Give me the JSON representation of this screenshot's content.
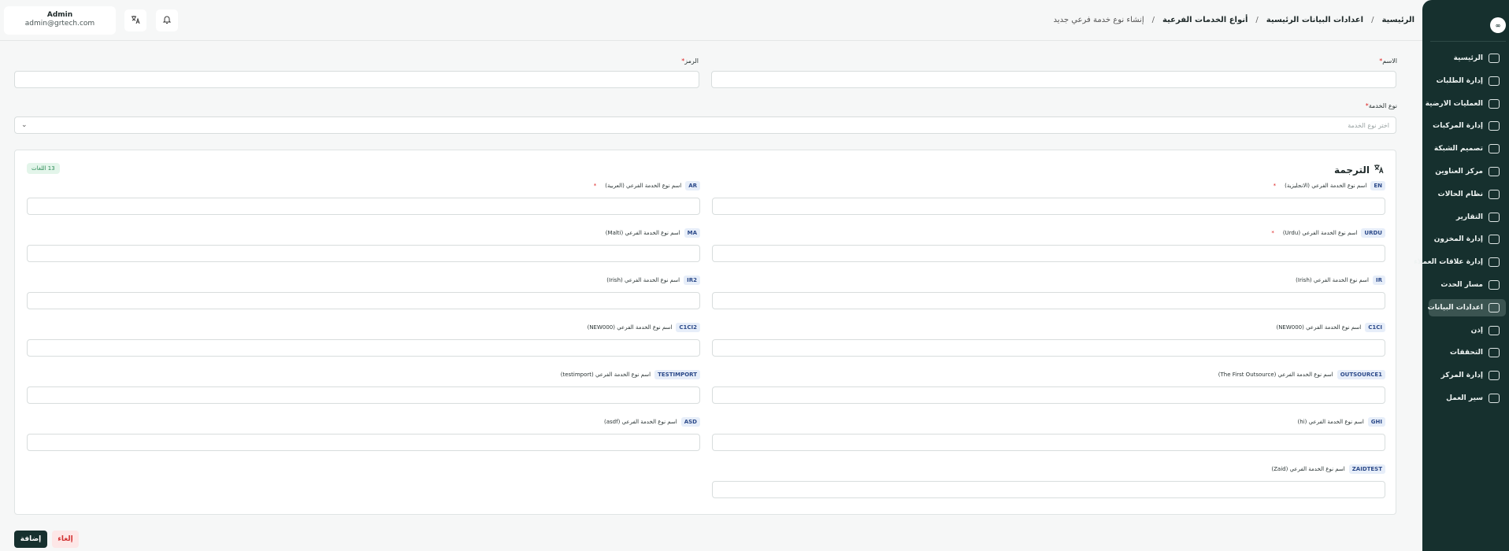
{
  "header": {
    "user_name": "Admin",
    "user_email": "admin@grtech.com",
    "breadcrumb": [
      "الرئيسية",
      "اعدادات البيانات الرئيسية",
      "أنواع الخدمات الفرعية"
    ],
    "breadcrumb_current": "إنشاء نوع خدمة فرعي جديد",
    "separator": "/"
  },
  "sidebar": {
    "logo": "∞",
    "items": [
      {
        "label": "الرئيسية",
        "icon": "dashboard-icon"
      },
      {
        "label": "إدارة الطلبات",
        "icon": "orders-icon"
      },
      {
        "label": "العمليات الارضية",
        "icon": "ground-ops-icon"
      },
      {
        "label": "إدارة المركبات",
        "icon": "truck-icon"
      },
      {
        "label": "تصميم الشبكة",
        "icon": "network-icon"
      },
      {
        "label": "مركز العناوين",
        "icon": "location-icon"
      },
      {
        "label": "نظام الحالات",
        "icon": "status-icon"
      },
      {
        "label": "التقارير",
        "icon": "reports-icon"
      },
      {
        "label": "إدارة المخزون",
        "icon": "inventory-icon"
      },
      {
        "label": "إدارة علاقات العملاء",
        "icon": "crm-icon"
      },
      {
        "label": "مسار الحدث",
        "icon": "event-path-icon"
      },
      {
        "label": "اعدادات البيانات",
        "icon": "database-icon",
        "active": true
      },
      {
        "label": "إذن",
        "icon": "users-icon"
      },
      {
        "label": "التحققات",
        "icon": "validation-icon"
      },
      {
        "label": "إدارة المركز",
        "icon": "hub-icon"
      },
      {
        "label": "سير العمل",
        "icon": "workflow-icon"
      }
    ]
  },
  "form": {
    "name_label": "الاسم",
    "code_label": "الرمز",
    "name_value": "",
    "code_value": "",
    "service_type_label": "نوع الخدمة",
    "service_type_placeholder": "اختر نوع الخدمة",
    "required_mark": "*"
  },
  "translation": {
    "title": "الترجمة",
    "langs_count": "13 اللغات",
    "fields": [
      {
        "code": "EN",
        "label": "اسم نوع الخدمة الفرعي (الانجليزية)",
        "required": true
      },
      {
        "code": "AR",
        "label": "اسم نوع الخدمة الفرعي (العربية)",
        "required": true
      },
      {
        "code": "URDU",
        "label": "اسم نوع الخدمة الفرعي (Urdu)",
        "required": true
      },
      {
        "code": "MA",
        "label": "اسم نوع الخدمة الفرعي (Malti)",
        "required": false
      },
      {
        "code": "IR",
        "label": "اسم نوع الخدمة الفرعي (Irish)",
        "required": false
      },
      {
        "code": "IR2",
        "label": "اسم نوع الخدمة الفرعي (Irish)",
        "required": false
      },
      {
        "code": "C1CI",
        "label": "اسم نوع الخدمة الفرعي (NEW000)",
        "required": false
      },
      {
        "code": "C1CI2",
        "label": "اسم نوع الخدمة الفرعي (NEW000)",
        "required": false
      },
      {
        "code": "OUTSOURCE1",
        "label": "اسم نوع الخدمة الفرعي (The First Outsource)",
        "required": false
      },
      {
        "code": "TESTIMPORT",
        "label": "اسم نوع الخدمة الفرعي (testimport)",
        "required": false
      },
      {
        "code": "GHI",
        "label": "اسم نوع الخدمة الفرعي (hi)",
        "required": false
      },
      {
        "code": "ASD",
        "label": "اسم نوع الخدمة الفرعي (asdf)",
        "required": false
      },
      {
        "code": "ZAIDTEST",
        "label": "اسم نوع الخدمة الفرعي (Zaid)",
        "required": false
      }
    ]
  },
  "actions": {
    "add_label": "إضافة",
    "cancel_label": "إلغاء"
  }
}
